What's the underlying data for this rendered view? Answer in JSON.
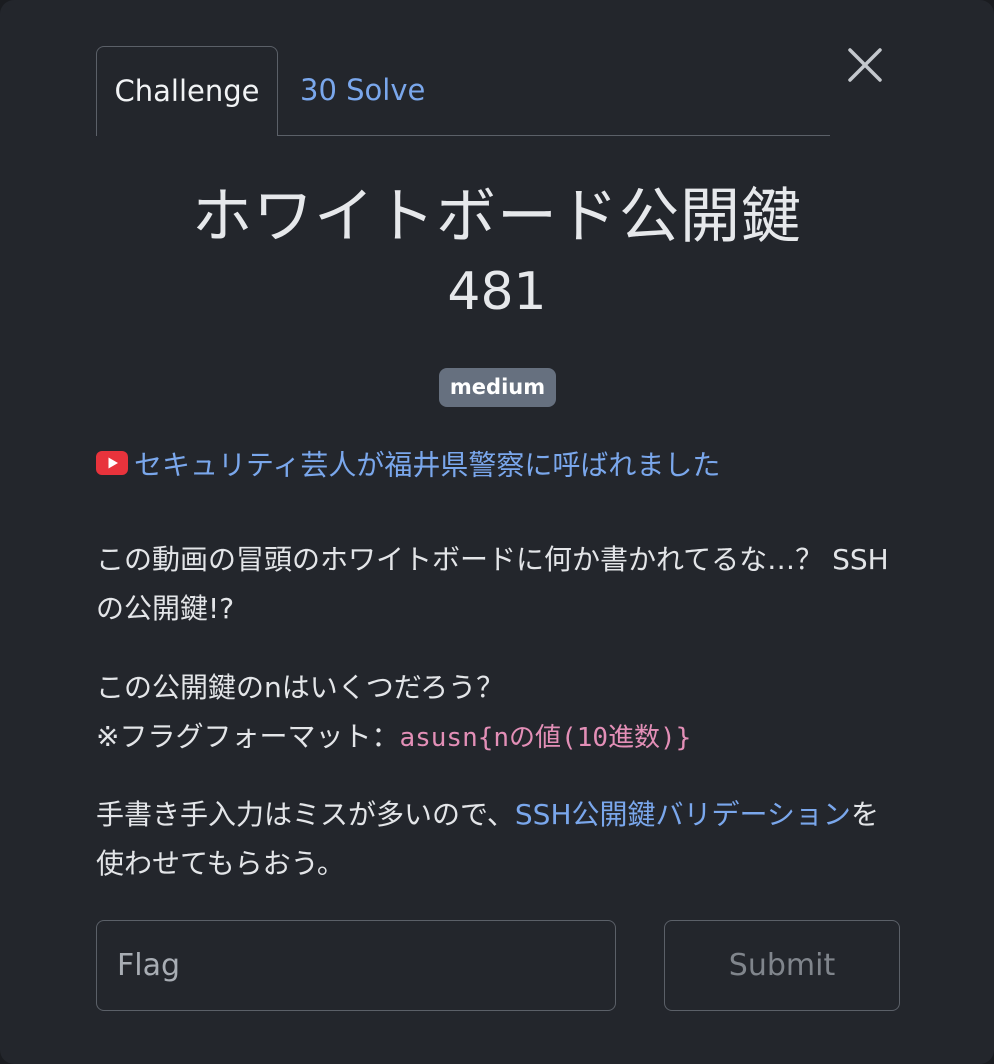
{
  "tabs": {
    "challenge_label": "Challenge",
    "solves_label": "30 Solve"
  },
  "challenge": {
    "title": "ホワイトボード公開鍵",
    "points": "481",
    "difficulty": "medium"
  },
  "video_link": {
    "icon": "youtube-icon",
    "text": "セキュリティ芸人が福井県警察に呼ばれました"
  },
  "description": {
    "p1": "この動画の冒頭のホワイトボードに何か書かれてるな…？ SSHの公開鍵!?",
    "p2_line1": "この公開鍵のnはいくつだろう？",
    "p2_line2_prefix": "※フラグフォーマット：",
    "p2_code": "asusn{nの値(10進数)}",
    "p3_prefix": "手書き手入力はミスが多いので、",
    "p3_link": "SSH公開鍵バリデーション",
    "p3_suffix": "を使わせてもらおう。"
  },
  "form": {
    "flag_placeholder": "Flag",
    "flag_value": "",
    "submit_label": "Submit"
  },
  "colors": {
    "background": "#23262c",
    "link": "#7aa7ec",
    "badge": "#66707f",
    "code": "#e38fb7",
    "youtube_red": "#e8333c"
  }
}
